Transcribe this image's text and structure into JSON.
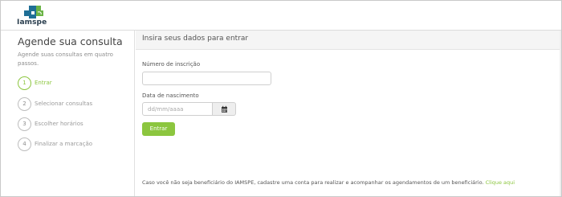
{
  "brand": {
    "name": "Iamspe",
    "logo_icon": "iamspe-cross-logo",
    "colors": {
      "accent": "#8cc63f",
      "logo_blue": "#1f6f96",
      "logo_green": "#6bb446"
    }
  },
  "sidebar": {
    "title": "Agende sua consulta",
    "subtitle": "Agende suas consultas em quatro passos.",
    "steps": [
      {
        "number": "1",
        "label": "Entrar",
        "active": true
      },
      {
        "number": "2",
        "label": "Selecionar consultas",
        "active": false
      },
      {
        "number": "3",
        "label": "Escolher horários",
        "active": false
      },
      {
        "number": "4",
        "label": "Finalizar a marcação",
        "active": false
      }
    ]
  },
  "main": {
    "header": "Insira seus dados para entrar",
    "form": {
      "inscricao_label": "Número de inscrição",
      "inscricao_value": "",
      "nascimento_label": "Data de nascimento",
      "nascimento_placeholder": "dd/mm/aaaa",
      "calendar_icon": "calendar-icon",
      "submit_label": "Entrar"
    },
    "footer": {
      "text": "Caso você não seja beneficiário do IAMSPE, cadastre uma conta para realizar e acompanhar os agendamentos de um beneficiário.",
      "link_text": "Clique aqui"
    }
  }
}
